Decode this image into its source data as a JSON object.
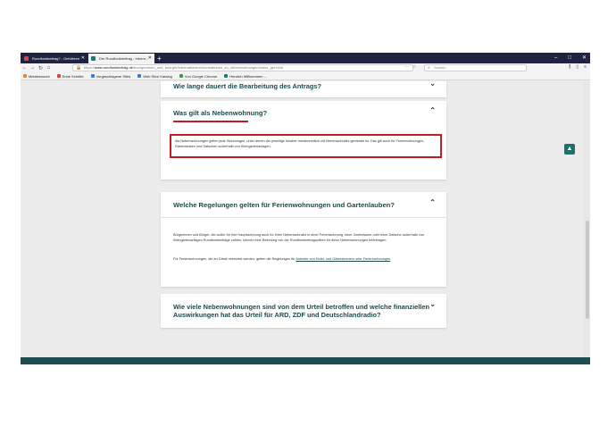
{
  "browser": {
    "tabs": [
      {
        "label": "Rundfunkbeitrag? - Gebühren",
        "active": false
      },
      {
        "label": "Der Rundfunkbeitrag - Inform...",
        "active": true
      }
    ],
    "new_tab": "+",
    "window_controls": [
      "–",
      "□",
      "✕"
    ],
    "nav": {
      "back": "←",
      "forward": "→",
      "reload": "↻",
      "home": "⌂"
    },
    "url": {
      "host": "www.rundfunkbeitrag.de",
      "path": "/buergerinnen_und_buerger/informationen/informationen_zu_nebenwohnungen/index_ger.html"
    },
    "url_icons": [
      "⋯",
      "☆"
    ],
    "search_placeholder": "Suchen",
    "bookmarks": [
      {
        "label": "Meistbesucht",
        "color": "#e08a2a"
      },
      {
        "label": "Erste Schritte",
        "color": "#e14040"
      },
      {
        "label": "Vorgeschlagene Sites",
        "color": "#3a7bd5"
      },
      {
        "label": "Web Slice Katalog",
        "color": "#3a7bd5"
      },
      {
        "label": "Von Google Chrome",
        "color": "#3a9a4a"
      },
      {
        "label": "Herzlich Willkommen ...",
        "color": "#1f7a72"
      }
    ]
  },
  "faq": {
    "item1_title": "Wie lange dauert die Bearbeitung des Antrags?",
    "item2_title": "Was gilt als Nebenwohnung?",
    "item2_body": "Als Nebenwohnungen gelten jene Wohnungen, unter denen der jeweilige Inhaber melderechtlich mit Nebenwohnsitz gemeldet ist. Das gilt auch für Ferienwohnungen, Gartenlauben und Datschen außerhalb von Kleingartenanlagen.",
    "item3_title": "Welche Regelungen gelten für Ferienwohnungen und Gartenlauben?",
    "item3_p1": "Bürgerinnen und Bürger, die außer für ihre Hauptwohnung auch für ihren Nebenwohnsitz in einer Ferienwohnung, einer Gartenlaube oder einer Datsche außerhalb von Kleingartenanlagen Rundfunkbeiträge zahlen, können eine Befreiung von der Rundfunkbeitragspflicht für diese Nebenwohnungen beantragen.",
    "item3_p2_prefix": "Für Ferienwohnungen, die an Gäste vermietet werden, gelten die Regelungen für ",
    "item3_p2_link": "Anbieter von Hotel- und Gästezimmern oder Ferienwohnungen",
    "item3_p2_suffix": ".",
    "item4_title": "Wie viele Nebenwohnungen sind von dem Urteil betroffen und welche finanziellen Auswirkungen hat das Urteil für ARD, ZDF und Deutschlandradio?",
    "chevron_up": "⌃",
    "chevron_down": "⌄",
    "to_top": "▲"
  }
}
